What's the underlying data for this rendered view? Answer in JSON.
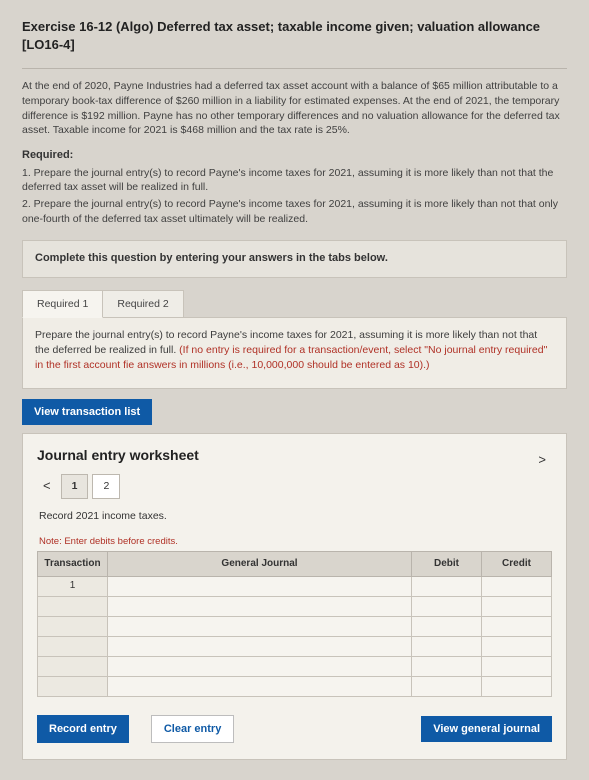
{
  "title": "Exercise 16-12 (Algo) Deferred tax asset; taxable income given; valuation allowance [LO16-4]",
  "scenario": "At the end of 2020, Payne Industries had a deferred tax asset account with a balance of $65 million attributable to a temporary book-tax difference of $260 million in a liability for estimated expenses. At the end of 2021, the temporary difference is $192 million. Payne has no other temporary differences and no valuation allowance for the deferred tax asset. Taxable income for 2021 is $468 million and the tax rate is 25%.",
  "required_label": "Required:",
  "required_items": [
    "1. Prepare the journal entry(s) to record Payne's income taxes for 2021, assuming it is more likely than not that the deferred tax asset will be realized in full.",
    "2. Prepare the journal entry(s) to record Payne's income taxes for 2021, assuming it is more likely than not that only one-fourth of the deferred tax asset ultimately will be realized."
  ],
  "instruction": "Complete this question by entering your answers in the tabs below.",
  "tabs": [
    {
      "label": "Required 1"
    },
    {
      "label": "Required 2"
    }
  ],
  "panel_text_a": "Prepare the journal entry(s) to record Payne's income taxes for 2021, assuming it is more likely than not that the deferred be realized in full. ",
  "panel_text_b": "(If no entry is required for a transaction/event, select \"No journal entry required\" in the first account fie answers in millions (i.e., 10,000,000 should be entered as 10).)",
  "view_transaction_list": "View transaction list",
  "worksheet": {
    "title": "Journal entry worksheet",
    "pages": [
      "1",
      "2"
    ],
    "subtitle": "Record 2021 income taxes.",
    "note": "Note: Enter debits before credits.",
    "columns": {
      "txn": "Transaction",
      "gj": "General Journal",
      "debit": "Debit",
      "credit": "Credit"
    },
    "first_txn": "1"
  },
  "buttons": {
    "record": "Record entry",
    "clear": "Clear entry",
    "view_general": "View general journal"
  },
  "chevrons": {
    "left": "<",
    "right": ">"
  }
}
